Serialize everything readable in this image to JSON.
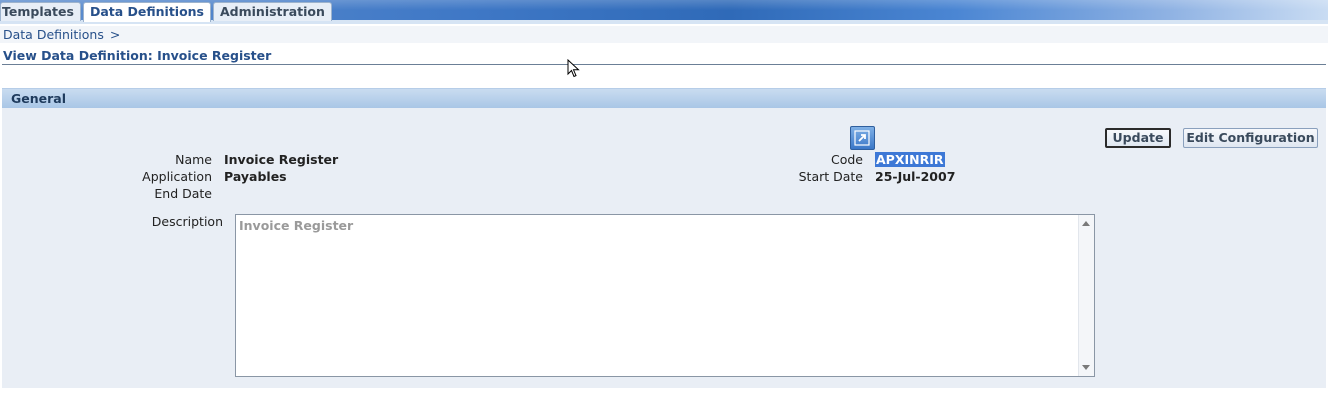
{
  "tabs": [
    {
      "label": "Templates",
      "active": false
    },
    {
      "label": "Data Definitions",
      "active": true
    },
    {
      "label": "Administration",
      "active": false
    }
  ],
  "breadcrumb": {
    "link": "Data Definitions",
    "separator": ">"
  },
  "page_title": "View Data Definition: Invoice Register",
  "general": {
    "header": "General",
    "name_label": "Name",
    "name_value": "Invoice Register",
    "application_label": "Application",
    "application_value": "Payables",
    "end_date_label": "End Date",
    "end_date_value": "",
    "code_label": "Code",
    "code_value": "APXINRIR",
    "start_date_label": "Start Date",
    "start_date_value": "25-Jul-2007",
    "description_label": "Description",
    "description_value": "Invoice Register"
  },
  "buttons": {
    "update": "Update",
    "edit_configuration": "Edit Configuration"
  },
  "icons": {
    "go_to": "external-link-icon",
    "cursor": "mouse-pointer-icon"
  },
  "colors": {
    "link_blue": "#27508a",
    "section_header": "#a9c6e6",
    "section_body": "#e9eef5",
    "selection": "#3d78d6"
  }
}
